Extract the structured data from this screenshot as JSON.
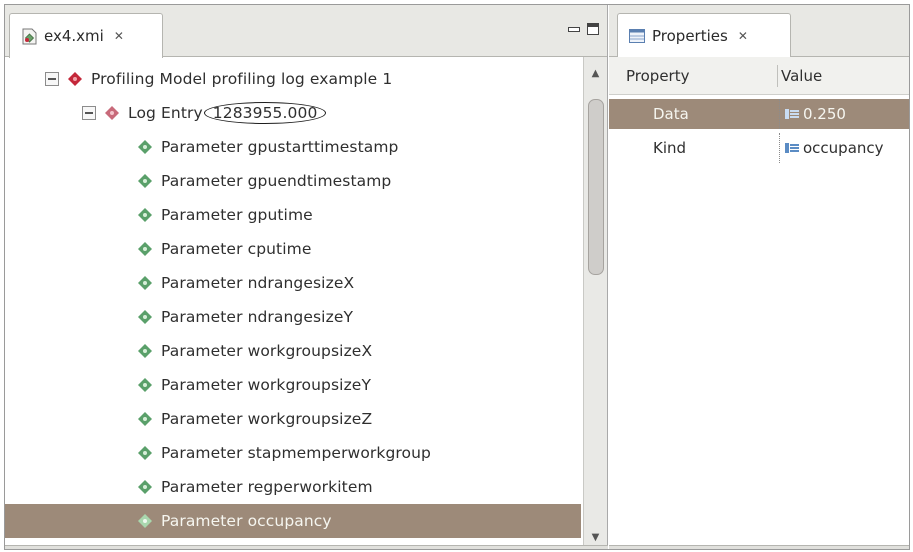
{
  "editor": {
    "tab_title": "ex4.xmi",
    "tab_close_symbol": "✕",
    "tab_icon": "xmi-file-icon",
    "tree": {
      "root": {
        "label": "Profiling Model profiling log example 1",
        "icon": "model-diamond-icon"
      },
      "entry": {
        "label": "Log Entry",
        "value": "1283955.000",
        "icon": "entry-diamond-icon"
      },
      "parameters": [
        "Parameter gpustarttimestamp",
        "Parameter gpuendtimestamp",
        "Parameter gputime",
        "Parameter cputime",
        "Parameter ndrangesizeX",
        "Parameter ndrangesizeY",
        "Parameter workgroupsizeX",
        "Parameter workgroupsizeY",
        "Parameter workgroupsizeZ",
        "Parameter stapmemperworkgroup",
        "Parameter regperworkitem",
        "Parameter occupancy"
      ],
      "selected_parameter": "Parameter occupancy"
    },
    "scroll_up_symbol": "▲",
    "scroll_down_symbol": "▼"
  },
  "properties": {
    "tab_title": "Properties",
    "tab_close_symbol": "✕",
    "tab_icon": "properties-table-icon",
    "columns": {
      "property": "Property",
      "value": "Value"
    },
    "rows": [
      {
        "name": "Data",
        "value": "0.250",
        "selected": true
      },
      {
        "name": "Kind",
        "value": "occupancy",
        "selected": false
      }
    ]
  },
  "colors": {
    "selection": "#9d8a79",
    "diamond_red": "#c4283a",
    "diamond_green": "#5aa06a",
    "value_icon_blue": "#5b8cc4"
  }
}
